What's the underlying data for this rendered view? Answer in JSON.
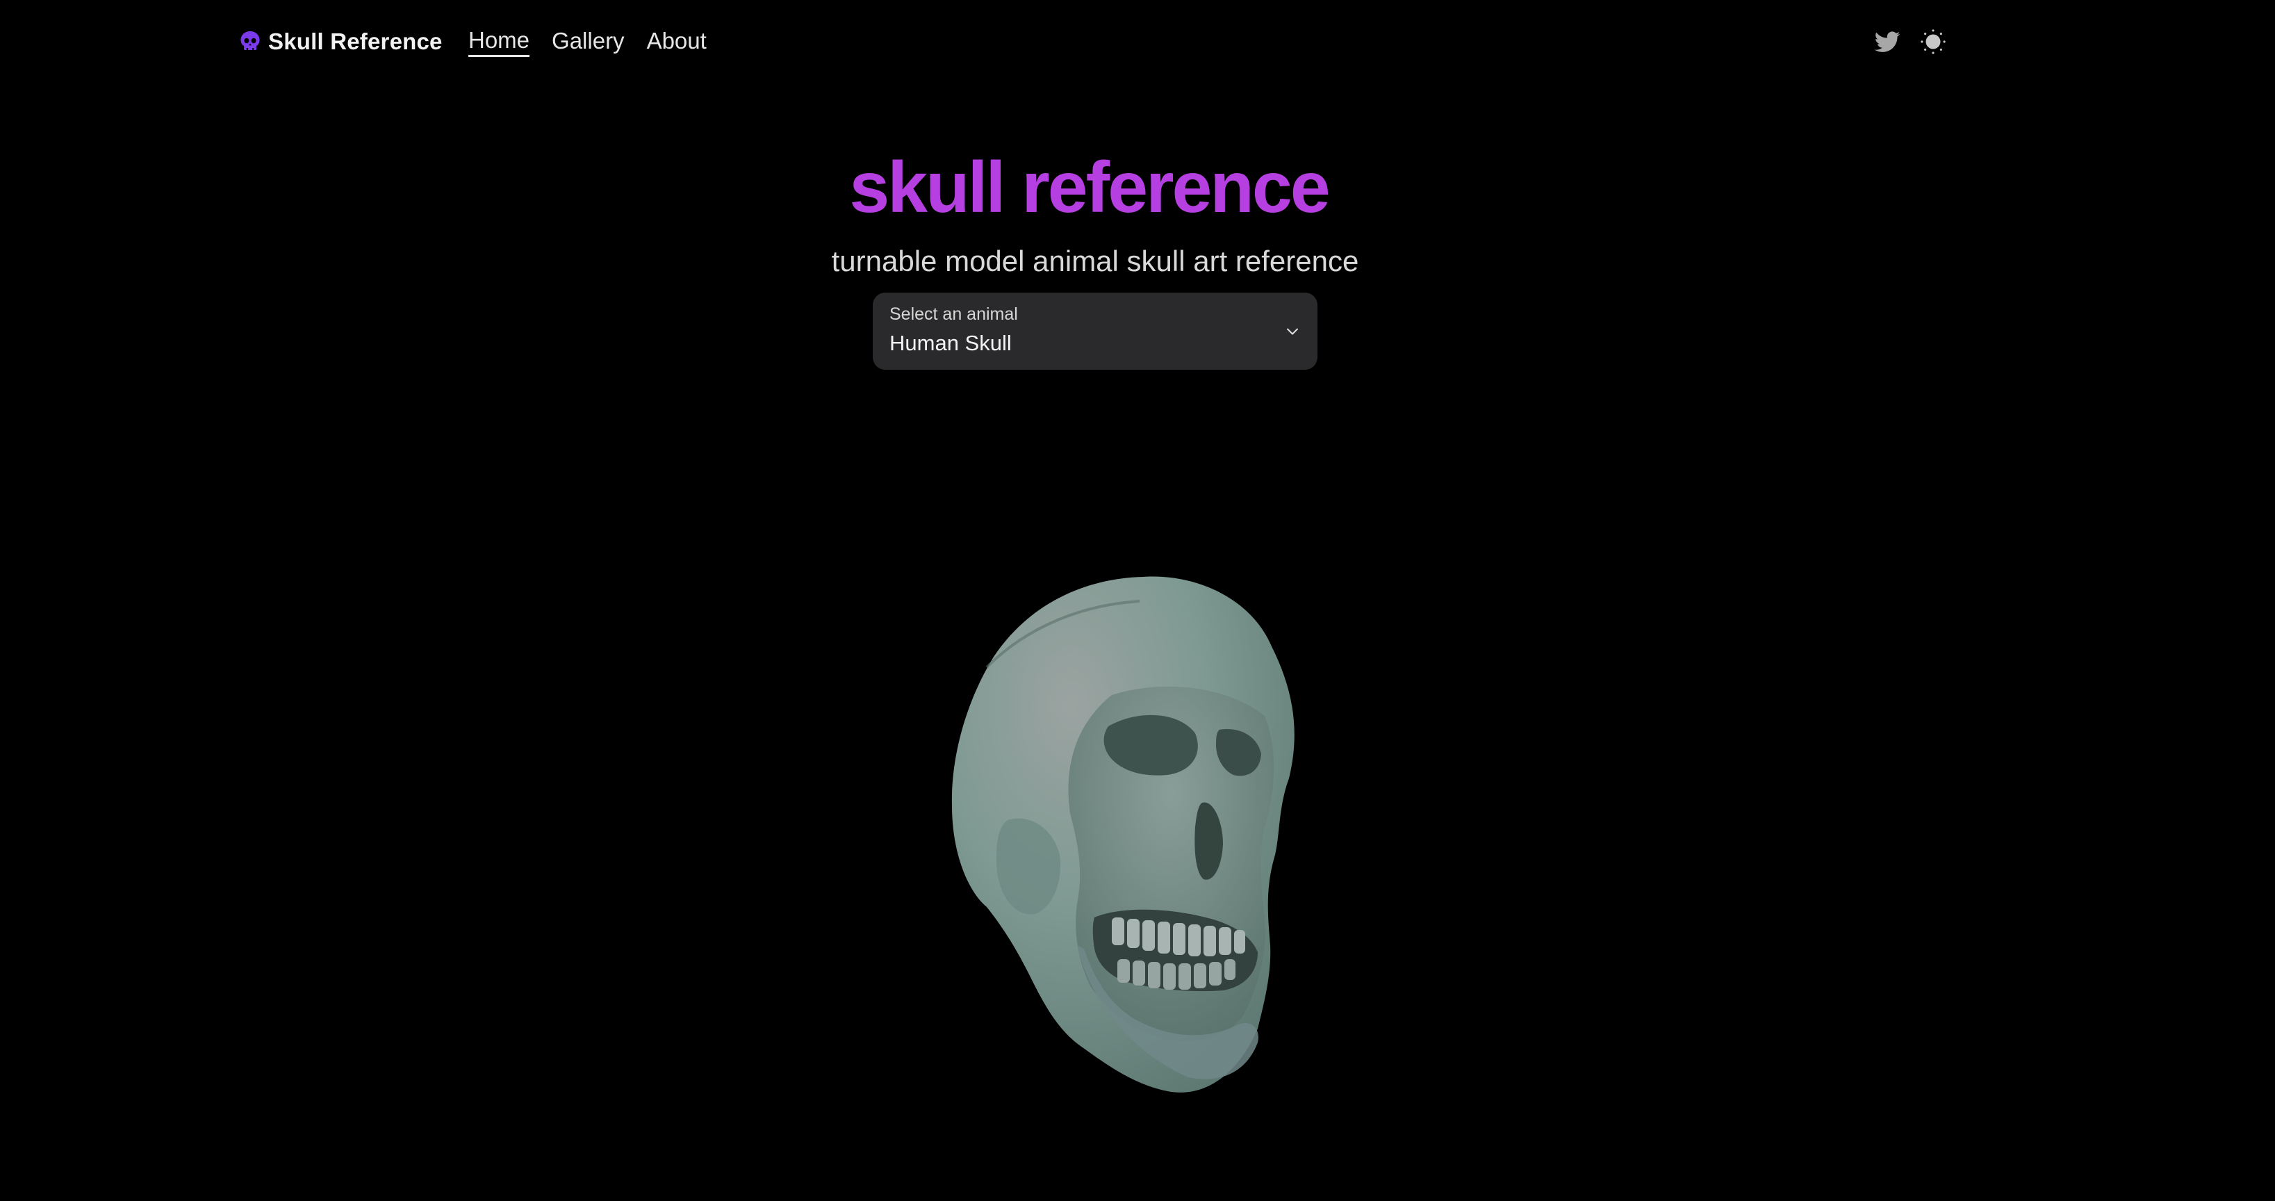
{
  "brand": {
    "name": "Skull Reference",
    "icon": "skull-icon",
    "icon_color": "#7c3aed"
  },
  "nav": {
    "links": [
      {
        "label": "Home",
        "active": true
      },
      {
        "label": "Gallery",
        "active": false
      },
      {
        "label": "About",
        "active": false
      }
    ],
    "right_icons": [
      "twitter-icon",
      "sun-icon"
    ]
  },
  "hero": {
    "title": "skull reference",
    "title_color": "#b53fe0",
    "subtitle": "turnable model animal skull art reference"
  },
  "animal_select": {
    "label": "Select an animal",
    "value": "Human Skull",
    "icon": "chevron-down-icon"
  },
  "model_viewer": {
    "model": "human skull 3d model",
    "tint": "#7f9a93"
  },
  "colors": {
    "background": "#000000",
    "select_bg": "#2a2a2c",
    "text": "#ececec"
  }
}
